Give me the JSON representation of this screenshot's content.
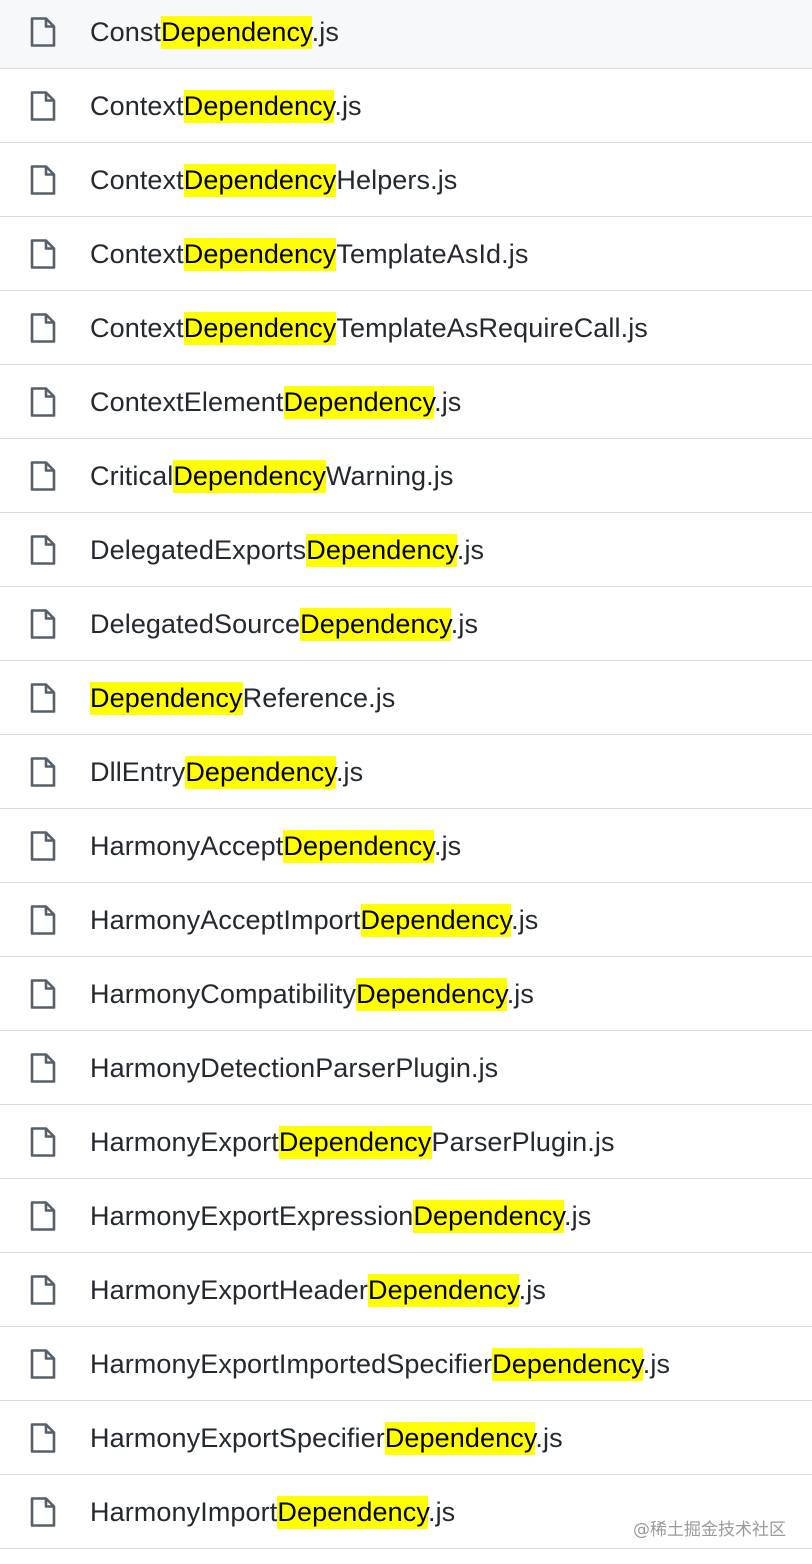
{
  "file_list": {
    "files": [
      {
        "pre": "Const",
        "match": "Dependency",
        "post": ".js"
      },
      {
        "pre": "Context",
        "match": "Dependency",
        "post": ".js"
      },
      {
        "pre": "Context",
        "match": "Dependency",
        "post": "Helpers.js"
      },
      {
        "pre": "Context",
        "match": "Dependency",
        "post": "TemplateAsId.js"
      },
      {
        "pre": "Context",
        "match": "Dependency",
        "post": "TemplateAsRequireCall.js"
      },
      {
        "pre": "ContextElement",
        "match": "Dependency",
        "post": ".js"
      },
      {
        "pre": "Critical",
        "match": "Dependency",
        "post": "Warning.js"
      },
      {
        "pre": "DelegatedExports",
        "match": "Dependency",
        "post": ".js"
      },
      {
        "pre": "DelegatedSource",
        "match": "Dependency",
        "post": ".js"
      },
      {
        "pre": "",
        "match": "Dependency",
        "post": "Reference.js"
      },
      {
        "pre": "DllEntry",
        "match": "Dependency",
        "post": ".js"
      },
      {
        "pre": "HarmonyAccept",
        "match": "Dependency",
        "post": ".js"
      },
      {
        "pre": "HarmonyAcceptImport",
        "match": "Dependency",
        "post": ".js"
      },
      {
        "pre": "HarmonyCompatibility",
        "match": "Dependency",
        "post": ".js"
      },
      {
        "pre": "HarmonyDetectionParserPlugin.js",
        "match": "",
        "post": ""
      },
      {
        "pre": "HarmonyExport",
        "match": "Dependency",
        "post": "ParserPlugin.js"
      },
      {
        "pre": "HarmonyExportExpression",
        "match": "Dependency",
        "post": ".js"
      },
      {
        "pre": "HarmonyExportHeader",
        "match": "Dependency",
        "post": ".js"
      },
      {
        "pre": "HarmonyExportImportedSpecifier",
        "match": "Dependency",
        "post": ".js"
      },
      {
        "pre": "HarmonyExportSpecifier",
        "match": "Dependency",
        "post": ".js"
      },
      {
        "pre": "HarmonyImport",
        "match": "Dependency",
        "post": ".js"
      }
    ],
    "file_icon": "file-icon",
    "highlight_color": "#ffff00",
    "first_row_background": "#f6f8fa",
    "divider_color": "#d8dee4",
    "text_color": "#24292f"
  },
  "watermark": "@稀土掘金技术社区"
}
